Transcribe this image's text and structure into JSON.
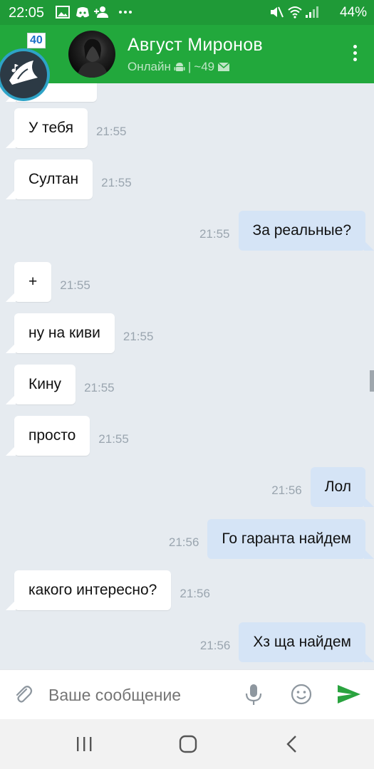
{
  "status_bar": {
    "time": "22:05",
    "battery": "44%"
  },
  "header": {
    "name": "Август Миронов",
    "status": "Онлайн",
    "separator": "|",
    "last_seen": "~49"
  },
  "chathead": {
    "badge": "40"
  },
  "messages": [
    {
      "dir": "in",
      "text": "У тебя",
      "time": "21:55"
    },
    {
      "dir": "in",
      "text": "Султан",
      "time": "21:55"
    },
    {
      "dir": "out",
      "text": "За реальные?",
      "time": "21:55"
    },
    {
      "dir": "in",
      "text": "+",
      "time": "21:55"
    },
    {
      "dir": "in",
      "text": "ну на киви",
      "time": "21:55"
    },
    {
      "dir": "in",
      "text": "Кину",
      "time": "21:55"
    },
    {
      "dir": "in",
      "text": "просто",
      "time": "21:55"
    },
    {
      "dir": "out",
      "text": "Лол",
      "time": "21:56"
    },
    {
      "dir": "out",
      "text": "Го гаранта найдем",
      "time": "21:56"
    },
    {
      "dir": "in",
      "text": "какого интересно?",
      "time": "21:56"
    },
    {
      "dir": "out",
      "text": "Хз ща найдем",
      "time": "21:56"
    }
  ],
  "composer": {
    "placeholder": "Ваше сообщение"
  },
  "icons": {
    "status": [
      "image-icon",
      "discord-icon",
      "add-contact-icon",
      "more-dots-icon",
      "mute-icon",
      "wifi-icon",
      "signal-icon"
    ],
    "header": [
      "android-icon",
      "mail-icon",
      "more-vert-icon"
    ],
    "composer": [
      "attach-icon",
      "mic-icon",
      "emoji-icon",
      "send-icon"
    ],
    "nav": [
      "recents-icon",
      "home-icon",
      "back-icon"
    ]
  },
  "colors": {
    "brand_green": "#22a83c",
    "incoming": "#ffffff",
    "outgoing": "#d5e4f6",
    "send": "#2aa33f"
  }
}
